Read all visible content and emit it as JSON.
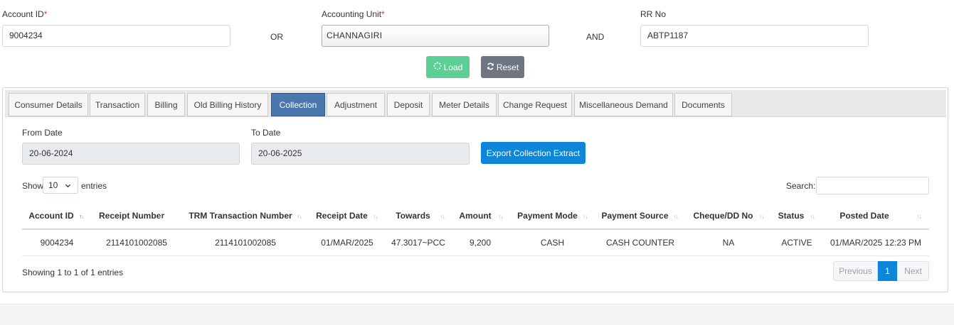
{
  "filters": {
    "account_id_label": "Account ID",
    "required_mark": "*",
    "account_id_value": "9004234",
    "or_text": "OR",
    "accounting_unit_label": "Accounting Unit",
    "accounting_unit_value": "CHANNAGIRI",
    "and_text": "AND",
    "rr_no_label": "RR No",
    "rr_no_value": "ABTP1187"
  },
  "actions": {
    "load_label": "Load",
    "reset_label": "Reset"
  },
  "tabs": [
    {
      "label": "Consumer Details"
    },
    {
      "label": "Transaction"
    },
    {
      "label": "Billing"
    },
    {
      "label": "Old Billing History"
    },
    {
      "label": "Collection",
      "active": true
    },
    {
      "label": "Adjustment"
    },
    {
      "label": "Deposit"
    },
    {
      "label": "Meter Details"
    },
    {
      "label": "Change Request"
    },
    {
      "label": "Miscellaneous Demand"
    },
    {
      "label": "Documents"
    }
  ],
  "collection": {
    "from_date_label": "From Date",
    "from_date_value": "20-06-2024",
    "to_date_label": "To Date",
    "to_date_value": "20-06-2025",
    "export_label": "Export Collection Extract"
  },
  "table_controls": {
    "show_label": "Show",
    "entries_value": "10",
    "entries_label": "entries",
    "search_label": "Search:"
  },
  "table": {
    "columns": [
      "Account ID",
      "Receipt Number",
      "TRM Transaction Number",
      "Receipt Date",
      "Towards",
      "Amount",
      "Payment Mode",
      "Payment Source",
      "Cheque/DD No",
      "Status",
      "Posted Date"
    ],
    "rows": [
      [
        "9004234",
        "2114101002085",
        "2114101002085",
        "01/MAR/2025",
        "47.3017~PCC",
        "9,200",
        "CASH",
        "CASH COUNTER",
        "NA",
        "ACTIVE",
        "01/MAR/2025 12:23 PM"
      ]
    ]
  },
  "footer": {
    "info": "Showing 1 to 1 of 1 entries",
    "previous_label": "Previous",
    "current_page": "1",
    "next_label": "Next"
  },
  "colors": {
    "load_button": "#5ccf95",
    "reset_button": "#6f7581",
    "export_button": "#0b86d9",
    "active_tab": "#4a78ae",
    "active_page": "#0b86d9",
    "required": "#dc3545"
  }
}
